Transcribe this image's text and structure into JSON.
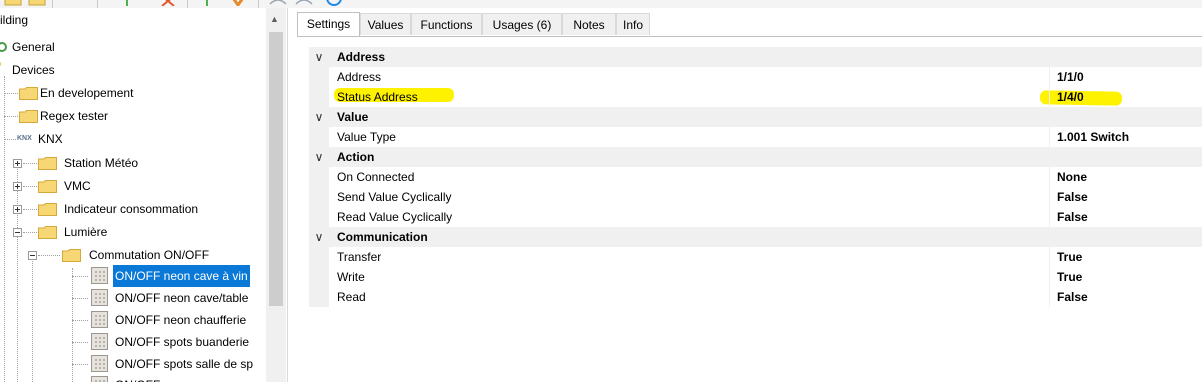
{
  "tree": {
    "items": [
      {
        "label": "ilding"
      },
      {
        "label": "General"
      },
      {
        "label": "Devices"
      },
      {
        "label": "En developement"
      },
      {
        "label": "Regex tester"
      },
      {
        "label": "KNX"
      },
      {
        "label": "Station Météo"
      },
      {
        "label": "VMC"
      },
      {
        "label": "Indicateur consommation"
      },
      {
        "label": "Lumière"
      },
      {
        "label": "Commutation ON/OFF"
      },
      {
        "label": "ON/OFF neon cave à vin"
      },
      {
        "label": "ON/OFF neon cave/table"
      },
      {
        "label": "ON/OFF neon chaufferie"
      },
      {
        "label": "ON/OFF spots buanderie"
      },
      {
        "label": "ON/OFF spots salle de sp"
      },
      {
        "label": "ON/OFF ..."
      }
    ],
    "knx_badge": "KNX"
  },
  "tabs": [
    {
      "label": "Settings"
    },
    {
      "label": "Values"
    },
    {
      "label": "Functions"
    },
    {
      "label": "Usages (6)"
    },
    {
      "label": "Notes"
    },
    {
      "label": "Info"
    }
  ],
  "properties": {
    "address": {
      "title": "Address",
      "rows": [
        {
          "name": "Address",
          "value": "1/1/0"
        },
        {
          "name": "Status Address",
          "value": "1/4/0"
        }
      ]
    },
    "value": {
      "title": "Value",
      "rows": [
        {
          "name": "Value Type",
          "value": "1.001 Switch"
        }
      ]
    },
    "action": {
      "title": "Action",
      "rows": [
        {
          "name": "On Connected",
          "value": "None"
        },
        {
          "name": "Send Value Cyclically",
          "value": "False"
        },
        {
          "name": "Read Value Cyclically",
          "value": "False"
        }
      ]
    },
    "communication": {
      "title": "Communication",
      "rows": [
        {
          "name": "Transfer",
          "value": "True"
        },
        {
          "name": "Write",
          "value": "True"
        },
        {
          "name": "Read",
          "value": "False"
        }
      ]
    }
  },
  "colors": {
    "selection": "#0a78d7",
    "highlight": "#fff200",
    "folder": "#f7d674",
    "category_bg": "#f0f0f0"
  }
}
